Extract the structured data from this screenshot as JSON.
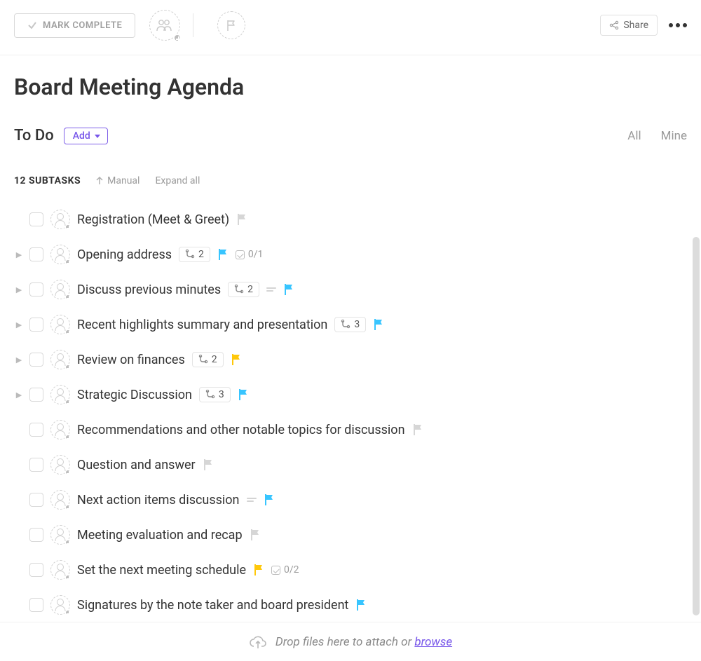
{
  "toolbar": {
    "mark_complete": "Mark Complete",
    "share": "Share"
  },
  "title": "Board Meeting Agenda",
  "section": {
    "name": "To Do",
    "add_label": "Add",
    "scope_all": "All",
    "scope_mine": "Mine"
  },
  "list_header": {
    "count_label": "12 Subtasks",
    "sort": "Manual",
    "expand": "Expand all"
  },
  "flag_colors": {
    "grey": "#d6d6d6",
    "blue": "#38c5ff",
    "yellow": "#ffc80a"
  },
  "tasks": [
    {
      "title": "Registration (Meet & Greet)",
      "expandable": false,
      "subtasks": null,
      "flag": "grey",
      "desc": false,
      "checklist": null
    },
    {
      "title": "Opening address",
      "expandable": true,
      "subtasks": 2,
      "flag": "blue",
      "desc": false,
      "checklist": "0/1"
    },
    {
      "title": "Discuss previous minutes",
      "expandable": true,
      "subtasks": 2,
      "flag": "blue",
      "desc": true,
      "checklist": null
    },
    {
      "title": "Recent highlights summary and presentation",
      "expandable": true,
      "subtasks": 3,
      "flag": "blue",
      "desc": false,
      "checklist": null
    },
    {
      "title": "Review on finances",
      "expandable": true,
      "subtasks": 2,
      "flag": "yellow",
      "desc": false,
      "checklist": null
    },
    {
      "title": "Strategic Discussion",
      "expandable": true,
      "subtasks": 3,
      "flag": "blue",
      "desc": false,
      "checklist": null
    },
    {
      "title": "Recommendations and other notable topics for discussion",
      "expandable": false,
      "subtasks": null,
      "flag": "grey",
      "desc": false,
      "checklist": null
    },
    {
      "title": "Question and answer",
      "expandable": false,
      "subtasks": null,
      "flag": "grey",
      "desc": false,
      "checklist": null
    },
    {
      "title": "Next action items discussion",
      "expandable": false,
      "subtasks": null,
      "flag": "blue",
      "desc": true,
      "checklist": null
    },
    {
      "title": "Meeting evaluation and recap",
      "expandable": false,
      "subtasks": null,
      "flag": "grey",
      "desc": false,
      "checklist": null
    },
    {
      "title": "Set the next meeting schedule",
      "expandable": false,
      "subtasks": null,
      "flag": "yellow",
      "desc": false,
      "checklist": "0/2"
    },
    {
      "title": "Signatures by the note taker and board president",
      "expandable": false,
      "subtasks": null,
      "flag": "blue",
      "desc": false,
      "checklist": null
    }
  ],
  "dropzone": {
    "text": "Drop files here to attach or ",
    "link": "browse"
  }
}
